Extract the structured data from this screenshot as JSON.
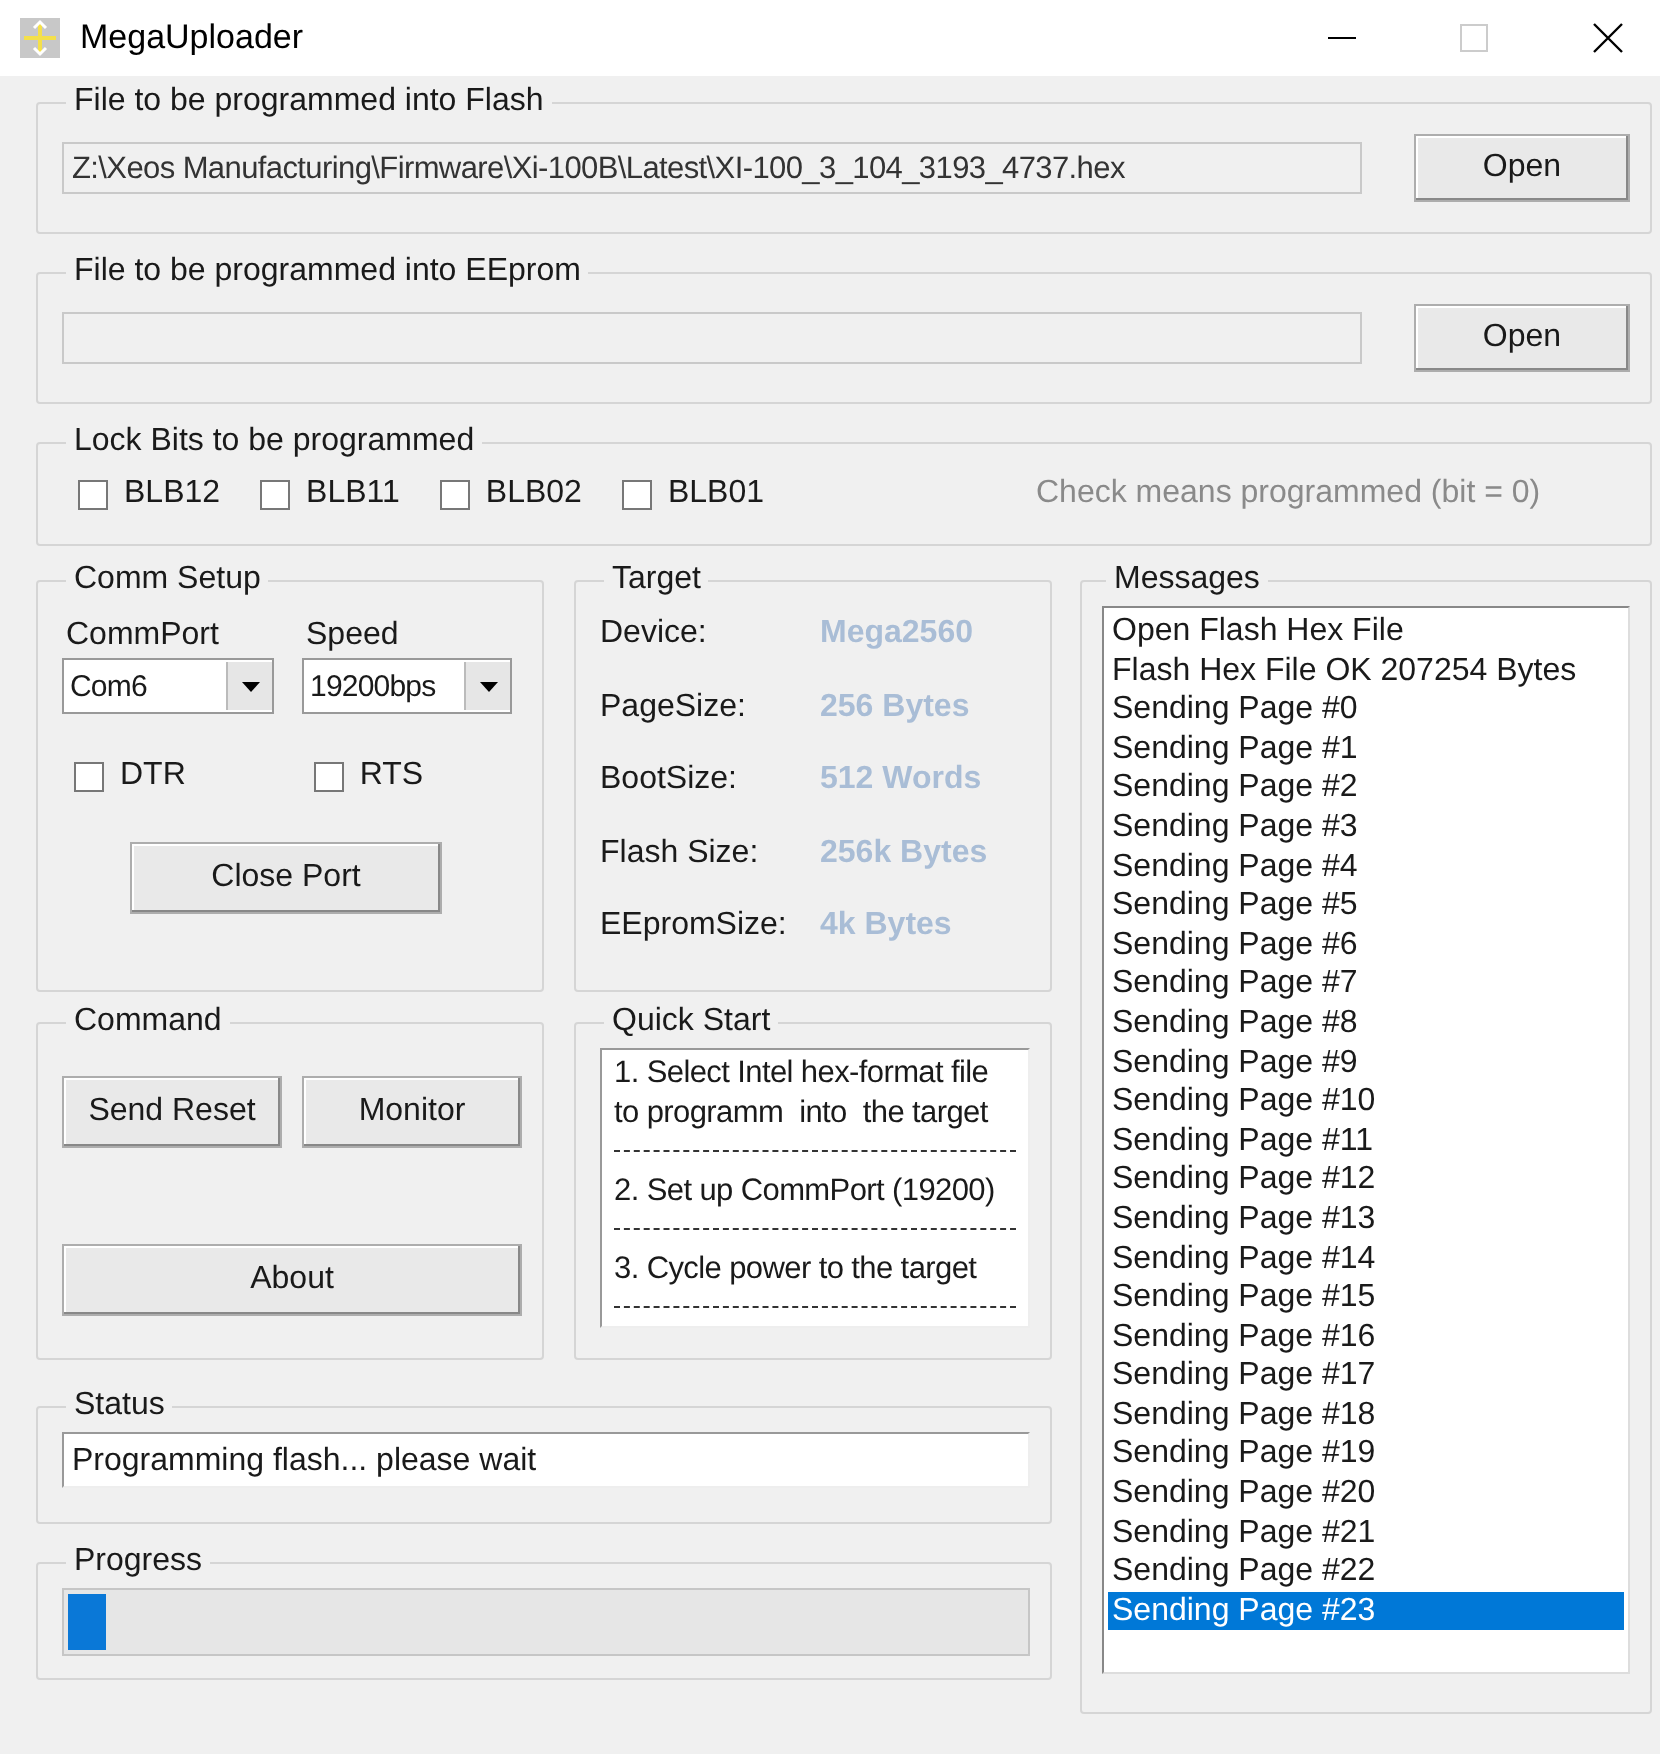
{
  "window": {
    "title": "MegaUploader"
  },
  "flash_file": {
    "label": "File to be programmed into Flash",
    "path": "Z:\\Xeos Manufacturing\\Firmware\\Xi-100B\\Latest\\XI-100_3_104_3193_4737.hex",
    "button": "Open"
  },
  "eeprom_file": {
    "label": "File to be programmed into EEprom",
    "button": "Open"
  },
  "lock_bits": {
    "label": "Lock Bits to be programmed",
    "bits": [
      {
        "label": "BLB12",
        "checked": false
      },
      {
        "label": "BLB11",
        "checked": false
      },
      {
        "label": "BLB02",
        "checked": false
      },
      {
        "label": "BLB01",
        "checked": false
      }
    ],
    "note": "Check means programmed (bit = 0)"
  },
  "comm_setup": {
    "label": "Comm Setup",
    "port_label": "CommPort",
    "port": "Com6",
    "speed_label": "Speed",
    "speed": "19200bps",
    "options": [
      {
        "label": "DTR",
        "checked": false
      },
      {
        "label": "RTS",
        "checked": false
      }
    ],
    "button": "Close Port"
  },
  "target": {
    "label": "Target",
    "rows": [
      {
        "name": "Device:",
        "value": "Mega2560"
      },
      {
        "name": "PageSize:",
        "value": "256 Bytes"
      },
      {
        "name": "BootSize:",
        "value": "512 Words"
      },
      {
        "name": "Flash Size:",
        "value": "256k Bytes"
      },
      {
        "name": "EEpromSize:",
        "value": "4k Bytes"
      }
    ]
  },
  "messages": {
    "label": "Messages",
    "items": [
      {
        "text": "Open Flash Hex File",
        "selected": false
      },
      {
        "text": "Flash Hex File OK 207254 Bytes",
        "selected": false
      },
      {
        "text": "Sending Page #0",
        "selected": false
      },
      {
        "text": "Sending Page #1",
        "selected": false
      },
      {
        "text": "Sending Page #2",
        "selected": false
      },
      {
        "text": "Sending Page #3",
        "selected": false
      },
      {
        "text": "Sending Page #4",
        "selected": false
      },
      {
        "text": "Sending Page #5",
        "selected": false
      },
      {
        "text": "Sending Page #6",
        "selected": false
      },
      {
        "text": "Sending Page #7",
        "selected": false
      },
      {
        "text": "Sending Page #8",
        "selected": false
      },
      {
        "text": "Sending Page #9",
        "selected": false
      },
      {
        "text": "Sending Page #10",
        "selected": false
      },
      {
        "text": "Sending Page #11",
        "selected": false
      },
      {
        "text": "Sending Page #12",
        "selected": false
      },
      {
        "text": "Sending Page #13",
        "selected": false
      },
      {
        "text": "Sending Page #14",
        "selected": false
      },
      {
        "text": "Sending Page #15",
        "selected": false
      },
      {
        "text": "Sending Page #16",
        "selected": false
      },
      {
        "text": "Sending Page #17",
        "selected": false
      },
      {
        "text": "Sending Page #18",
        "selected": false
      },
      {
        "text": "Sending Page #19",
        "selected": false
      },
      {
        "text": "Sending Page #20",
        "selected": false
      },
      {
        "text": "Sending Page #21",
        "selected": false
      },
      {
        "text": "Sending Page #22",
        "selected": false
      },
      {
        "text": "Sending Page #23",
        "selected": true
      }
    ]
  },
  "command": {
    "label": "Command",
    "buttons": [
      "Send Reset",
      "Monitor",
      "About"
    ]
  },
  "quick_start": {
    "label": "Quick Start",
    "steps": [
      "1. Select Intel hex-format file to programm  into  the target",
      "2. Set up CommPort (19200)",
      "3. Cycle power to the target"
    ]
  },
  "status": {
    "label": "Status",
    "value": "Programming flash... please wait"
  },
  "progress": {
    "label": "Progress",
    "level": 0.04
  }
}
